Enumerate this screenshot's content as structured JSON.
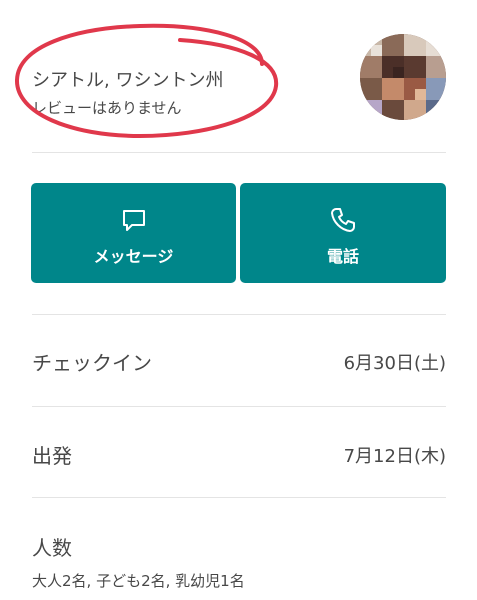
{
  "host": {
    "location": "シアトル, ワシントン州",
    "reviews": "レビューはありません",
    "avatar_icon": "avatar-pixelated",
    "annotation_color": "#e0384b"
  },
  "actions": {
    "message_label": "メッセージ",
    "message_icon": "chat-bubble-icon",
    "call_label": "電話",
    "call_icon": "phone-icon",
    "button_color": "#00868a"
  },
  "details": {
    "checkin_label": "チェックイン",
    "checkin_value": "6月30日(土)",
    "checkout_label": "出発",
    "checkout_value": "7月12日(木)",
    "guests_label": "人数",
    "guests_value": "大人2名, 子ども2名, 乳幼児1名"
  }
}
